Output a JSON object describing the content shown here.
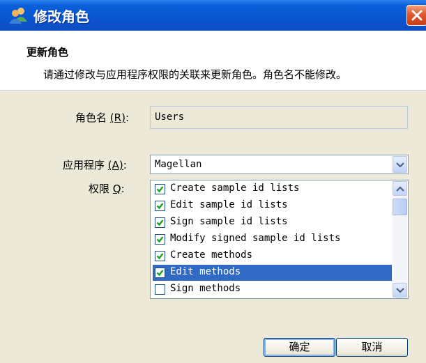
{
  "window": {
    "title": "修改角色",
    "title_icon": "users-icon",
    "close_icon": "close-icon"
  },
  "header": {
    "title": "更新角色",
    "description": "请通过修改与应用程序权限的关联来更新角色。角色名不能修改。"
  },
  "form": {
    "role_name_label": "角色名",
    "role_name_hotkey": "(R)",
    "role_name_colon": ":",
    "role_name_value": "Users",
    "app_label": "应用程序",
    "app_hotkey": "(A)",
    "app_colon": ":",
    "app_value": "Magellan",
    "perm_label": "权限",
    "perm_hotkey": "Q",
    "perm_colon": ":",
    "permissions": [
      {
        "label": "Create sample id lists",
        "checked": true
      },
      {
        "label": "Edit sample id lists",
        "checked": true
      },
      {
        "label": "Sign sample id lists",
        "checked": true
      },
      {
        "label": "Modify signed sample id lists",
        "checked": true
      },
      {
        "label": "Create methods",
        "checked": true
      },
      {
        "label": "Edit methods",
        "checked": true,
        "selected": true
      },
      {
        "label": "Sign methods",
        "checked": false
      }
    ]
  },
  "buttons": {
    "ok": "确定",
    "cancel": "取消"
  },
  "colors": {
    "titlebar": "#0a55d0",
    "selection": "#316ac5",
    "dialog_bg": "#ece9d8",
    "check": "#21a121"
  }
}
